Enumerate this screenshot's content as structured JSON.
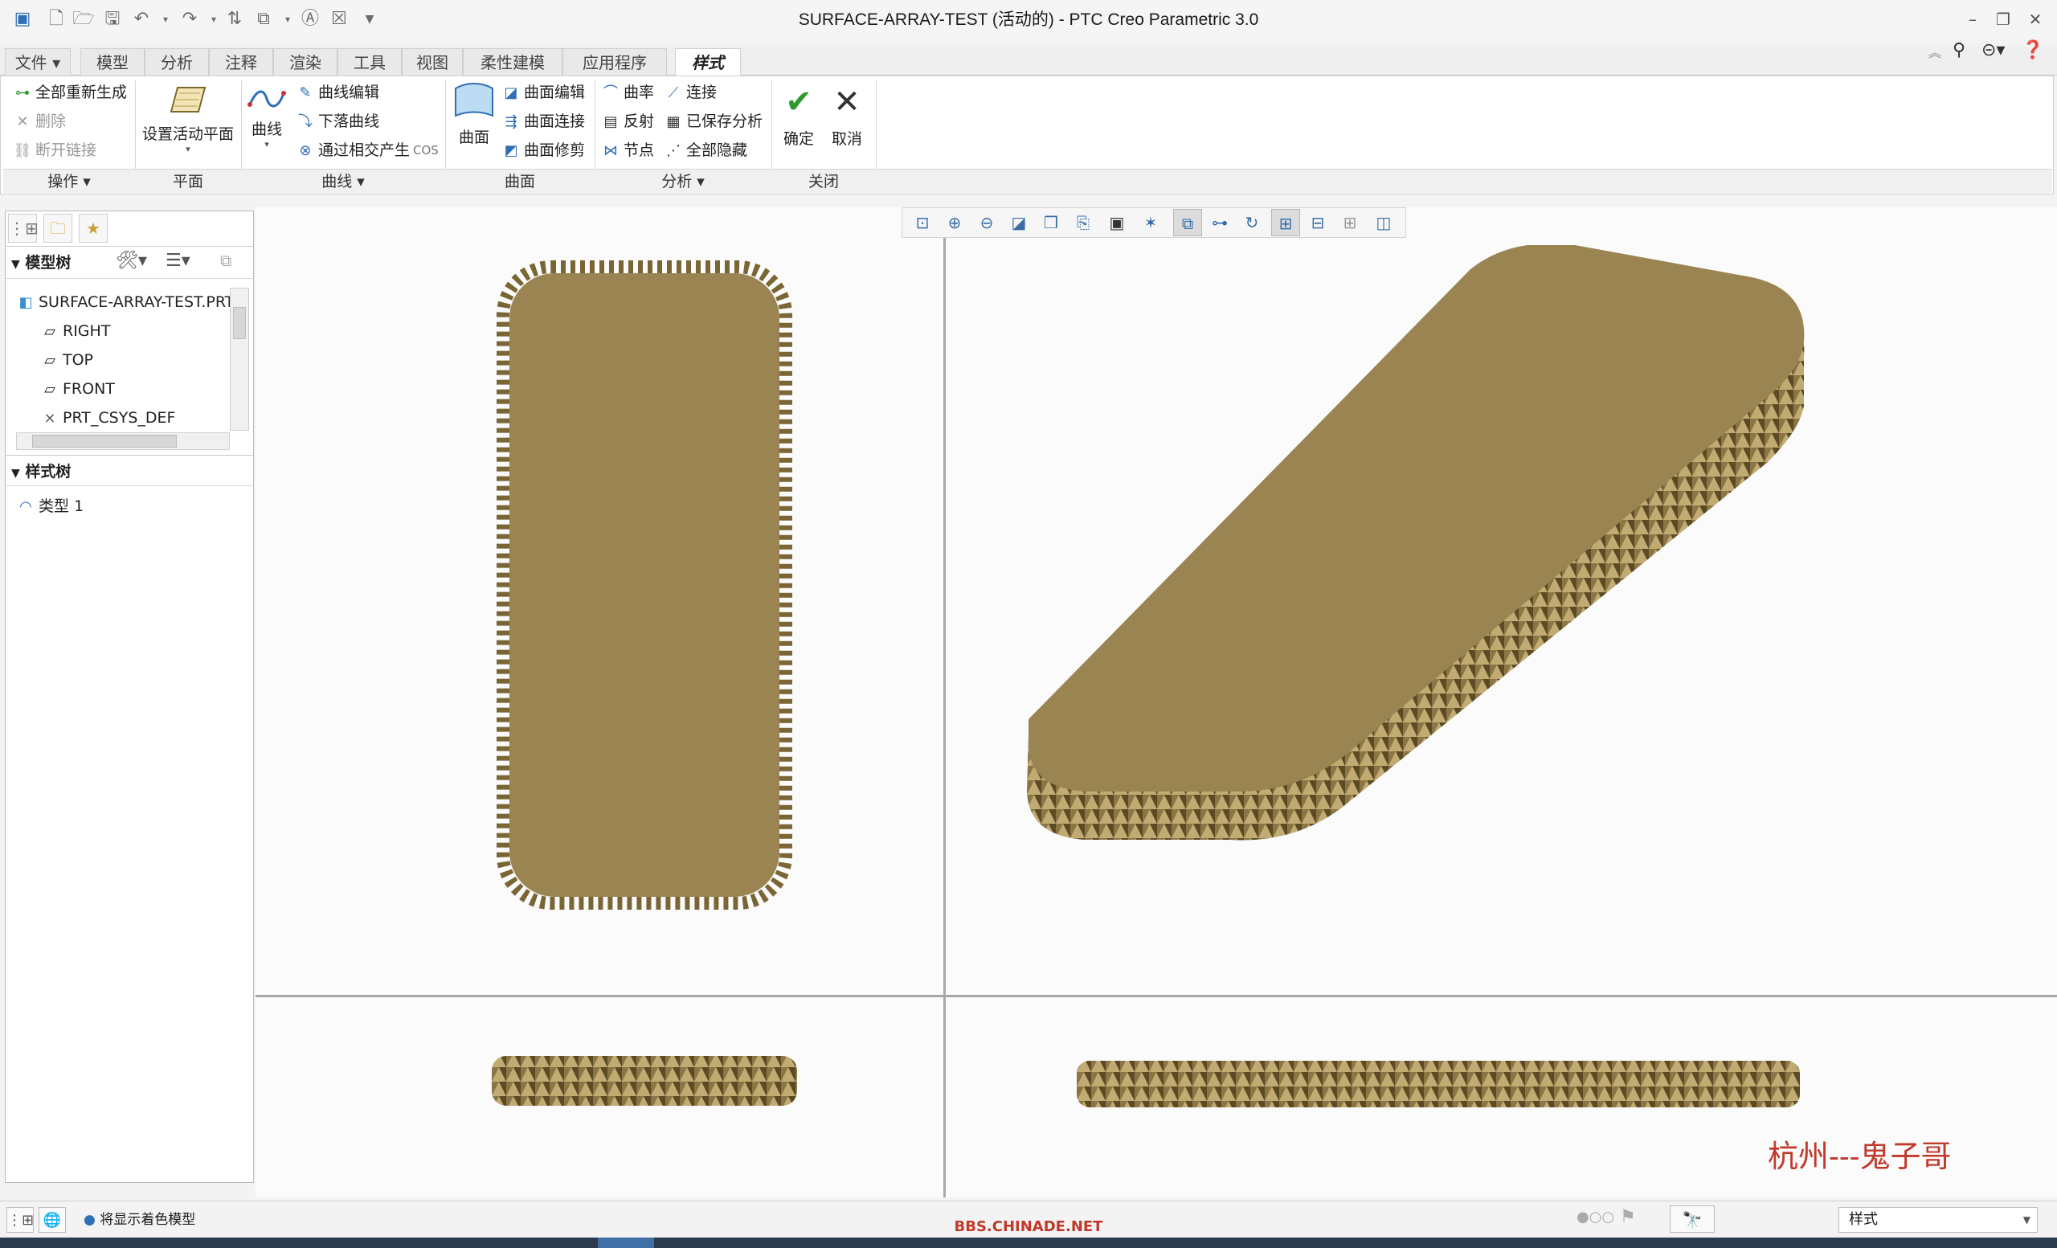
{
  "window": {
    "title": "SURFACE-ARRAY-TEST (活动的) - PTC Creo Parametric 3.0"
  },
  "ribbon_tabs": [
    {
      "label": "文件",
      "has_dropdown": true
    },
    {
      "label": "模型"
    },
    {
      "label": "分析"
    },
    {
      "label": "注释"
    },
    {
      "label": "渲染"
    },
    {
      "label": "工具"
    },
    {
      "label": "视图"
    },
    {
      "label": "柔性建模"
    },
    {
      "label": "应用程序"
    },
    {
      "label": "样式",
      "active": true
    }
  ],
  "ribbon": {
    "operations": {
      "regenerate_all": "全部重新生成",
      "delete": "删除",
      "break_link": "断开链接",
      "group_label": "操作"
    },
    "plane": {
      "set_active_plane": "设置活动平面",
      "group_label": "平面"
    },
    "curves": {
      "curve": "曲线",
      "curve_edit": "曲线编辑",
      "drop_curve": "下落曲线",
      "intersect": "通过相交产生",
      "cos": "COS",
      "group_label": "曲线"
    },
    "surfaces": {
      "surface": "曲面",
      "surface_edit": "曲面编辑",
      "surface_connect": "曲面连接",
      "surface_trim": "曲面修剪",
      "group_label": "曲面"
    },
    "analysis": {
      "curvature": "曲率",
      "connect": "连接",
      "reflection": "反射",
      "saved_analysis": "已保存分析",
      "node": "节点",
      "hide_all": "全部隐藏",
      "group_label": "分析"
    },
    "close": {
      "ok": "确定",
      "cancel": "取消",
      "group_label": "关闭"
    }
  },
  "model_tree": {
    "header": "模型树",
    "root": "SURFACE-ARRAY-TEST.PRT",
    "items": [
      "RIGHT",
      "TOP",
      "FRONT",
      "PRT_CSYS_DEF"
    ]
  },
  "style_tree": {
    "header": "样式树",
    "items": [
      "类型 1"
    ]
  },
  "viewport": {
    "watermark": "杭州---鬼子哥",
    "model_color": "#9a8452"
  },
  "status": {
    "message": "将显示着色模型",
    "footer_url": "BBS.CHINADE.NET",
    "filter_value": "样式"
  },
  "colors": {
    "accent_blue": "#2f6fb6",
    "ok_green": "#2e9a2e",
    "model_gold": "#9a8452"
  }
}
